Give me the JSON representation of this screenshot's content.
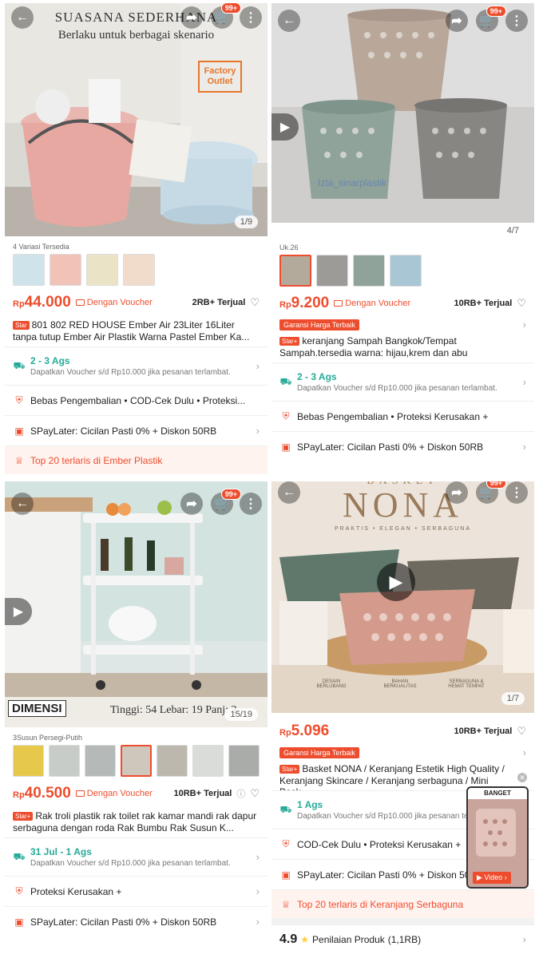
{
  "products": [
    {
      "hero": {
        "headline": "SUASANA SEDERHANA",
        "subheadline": "Berlaku untuk berbagai skenario",
        "badge": "Factory\nOutlet",
        "counter": "1/9",
        "cart_count": "99+"
      },
      "variants_label": "4 Variasi Tersedia",
      "price_currency": "Rp",
      "price": "44.000",
      "voucher": "Dengan Voucher",
      "sold": "2RB+ Terjual",
      "title_tag": "Star",
      "title": "801 802 RED HOUSE Ember Air 23Liter 16Liter tanpa tutup  Ember Air Plastik Warna Pastel Ember Ka...",
      "shipping": {
        "main": "2 - 3 Ags",
        "sub": "Dapatkan Voucher s/d Rp10.000 jika pesanan terlambat."
      },
      "perks": "Bebas Pengembalian  •  COD-Cek Dulu  •  Proteksi...",
      "paylater": "SPayLater: Cicilan Pasti 0% + Diskon 50RB",
      "top20": "Top 20 terlaris di Ember Plastik"
    },
    {
      "hero": {
        "watermark": "Izta_sinarplastik",
        "counter": "4/7",
        "cart_count": "99+"
      },
      "variants_label": "Uk.26",
      "price_currency": "Rp",
      "price": "9.200",
      "voucher": "Dengan Voucher",
      "sold": "10RB+ Terjual",
      "guarantee": "Garansi Harga Terbaik",
      "title_tag": "Star+",
      "title": "keranjang Sampah Bangkok/Tempat Sampah.tersedia warna: hijau,krem dan abu",
      "shipping": {
        "main": "2 - 3 Ags",
        "sub": "Dapatkan Voucher s/d Rp10.000 jika pesanan terlambat."
      },
      "perks": "Bebas Pengembalian  •  Proteksi Kerusakan +",
      "paylater": "SPayLater: Cicilan Pasti 0% + Diskon 50RB"
    },
    {
      "hero": {
        "dim_label": "DIMENSI",
        "dim_text": "Tinggi: 54 Lebar: 19 Panj: 2",
        "counter": "15/19",
        "cart_count": "99+"
      },
      "variants_label": "3Susun Persegi-Putih",
      "price_currency": "Rp",
      "price": "40.500",
      "voucher": "Dengan Voucher",
      "sold": "10RB+ Terjual",
      "title_tag": "Star+",
      "title": "Rak troli plastik rak toilet rak kamar mandi rak dapur serbaguna dengan roda Rak Bumbu Rak Susun K...",
      "shipping": {
        "main": "31 Jul - 1 Ags",
        "sub": "Dapatkan Voucher s/d Rp10.000 jika pesanan terlambat."
      },
      "perks": "Proteksi Kerusakan +",
      "paylater": "SPayLater: Cicilan Pasti 0% + Diskon 50RB"
    },
    {
      "hero": {
        "brand_top": "BASKET",
        "brand": "NONA",
        "tagline": "PRAKTIS • ELEGAN • SERBAGUNA",
        "features": [
          "DESAIN BERLUBANG",
          "BAHAN BERKUALITAS",
          "SERBAGUNA & HEMAT TEMPAT"
        ],
        "counter": "1/7",
        "cart_count": "99+"
      },
      "price_currency": "Rp",
      "price": "5.096",
      "sold": "10RB+ Terjual",
      "guarantee": "Garansi Harga Terbaik",
      "title_tag": "Star+",
      "title": "Basket NONA / Keranjang Estetik High Quality / Keranjang Skincare / Keranjang serbaguna / Mini Bask...",
      "shipping": {
        "main": "1 Ags",
        "sub": "Dapatkan Voucher s/d Rp10.000 jika pesanan terlambat."
      },
      "perks": "COD-Cek Dulu  •  Proteksi Kerusakan +",
      "paylater": "SPayLater: Cicilan Pasti 0% + Diskon 50",
      "top20": "Top 20 terlaris di Keranjang Serbaguna",
      "rating": {
        "value": "4.9",
        "label": "Penilaian Produk",
        "count": "(1,1RB)"
      },
      "mini_video": {
        "banner": "BANGET",
        "label": "Video"
      }
    }
  ],
  "colors": {
    "brand": "#ee4d2d",
    "ship": "#26aa99"
  }
}
